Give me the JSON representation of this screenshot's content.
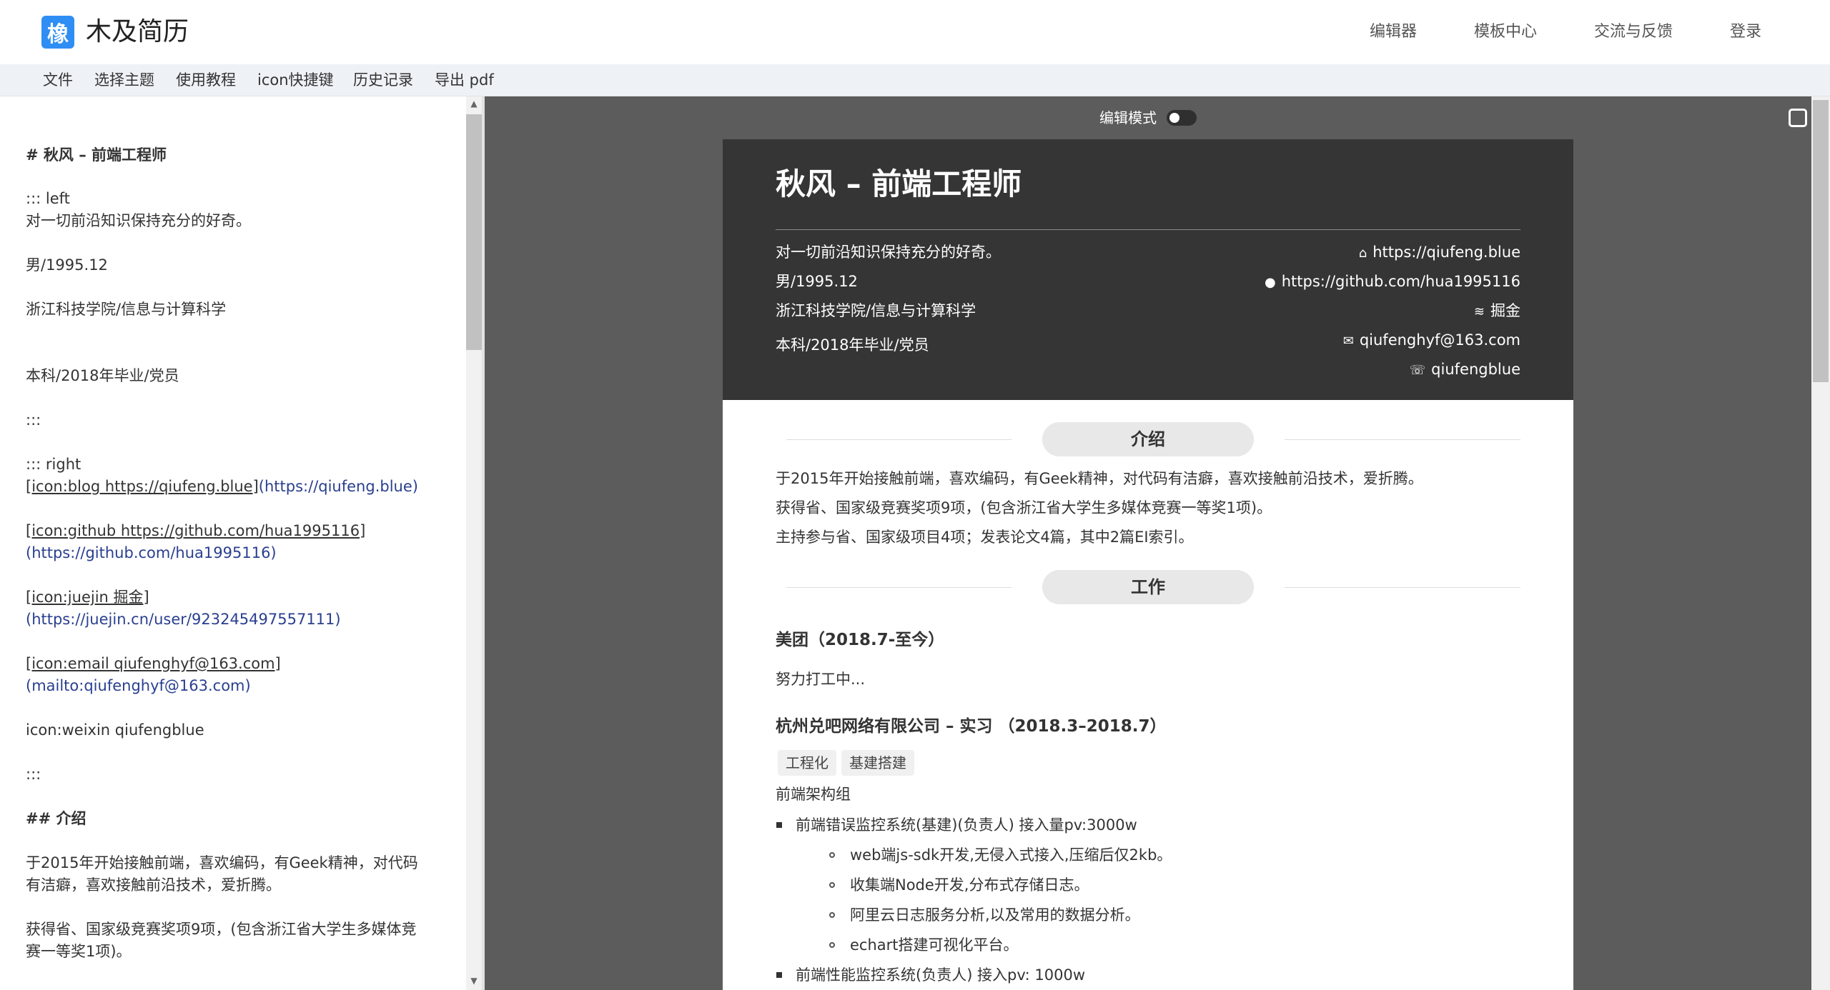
{
  "app": {
    "logo_glyph": "橡",
    "brand": "木及简历"
  },
  "nav": [
    "编辑器",
    "模板中心",
    "交流与反馈",
    "登录"
  ],
  "menu": [
    "文件",
    "选择主题",
    "使用教程",
    "icon快捷键",
    "历史记录",
    "导出 pdf"
  ],
  "editor": {
    "lines": [
      "# 秋风 – 前端工程师",
      "::: left",
      "对一切前沿知识保持充分的好奇。",
      "男/1995.12",
      "浙江科技学院/信息与计算科学",
      "本科/2018年毕业/党员",
      ":::",
      "::: right",
      "[icon:blog https://qiufeng.blue]",
      "(https://qiufeng.blue)",
      "[icon:github https://github.com/hua1995116]",
      "(https://github.com/hua1995116)",
      "[icon:juejin 掘金]",
      "(https://juejin.cn/user/923245497557111)",
      "[icon:email qiufenghyf@163.com]",
      "(mailto:qiufenghyf@163.com)",
      "icon:weixin qiufengblue",
      ":::",
      "## 介绍",
      "于2015年开始接触前端，喜欢编码，有Geek精神，对代码",
      "有洁癖，喜欢接触前沿技术，爱折腾。",
      "获得省、国家级竞赛奖项9项，(包含浙江省大学生多媒体竞",
      "赛一等奖1项)。"
    ]
  },
  "preview": {
    "edit_mode_label": "编辑模式",
    "edit_mode_on": false,
    "resume": {
      "name": "秋风 – 前端工程师",
      "left_info": [
        "对一切前沿知识保持充分的好奇。",
        "男/1995.12",
        "浙江科技学院/信息与计算科学",
        "本科/2018年毕业/党员"
      ],
      "contacts": [
        {
          "icon": "home-icon",
          "text": "https://qiufeng.blue"
        },
        {
          "icon": "github-icon",
          "text": "https://github.com/hua1995116"
        },
        {
          "icon": "juejin-icon",
          "text": "掘金"
        },
        {
          "icon": "email-icon",
          "text": "qiufenghyf@163.com"
        },
        {
          "icon": "wechat-icon",
          "text": "qiufengblue"
        }
      ],
      "sections": {
        "intro_title": "介绍",
        "intro_lines": [
          "于2015年开始接触前端，喜欢编码，有Geek精神，对代码有洁癖，喜欢接触前沿技术，爱折腾。",
          "获得省、国家级竞赛奖项9项，(包含浙江省大学生多媒体竞赛一等奖1项)。",
          "主持参与省、国家级项目4项；发表论文4篇，其中2篇EI索引。"
        ],
        "work_title": "工作",
        "job1_title": "美团（2018.7-至今）",
        "job1_desc": "努力打工中...",
        "job2_title": "杭州兑吧网络有限公司 – 实习 （2018.3–2018.7）",
        "job2_tags": [
          "工程化",
          "基建搭建"
        ],
        "job2_group": "前端架构组",
        "job2_item1": "前端错误监控系统(基建)(负责人) 接入量pv:3000w",
        "job2_subitems": [
          "web端js-sdk开发,无侵入式接入,压缩后仅2kb。",
          "收集端Node开发,分布式存储日志。",
          "阿里云日志服务分析,以及常用的数据分析。",
          "echart搭建可视化平台。"
        ],
        "job2_item2": "前端性能监控系统(负责人) 接入pv: 1000w"
      }
    }
  }
}
